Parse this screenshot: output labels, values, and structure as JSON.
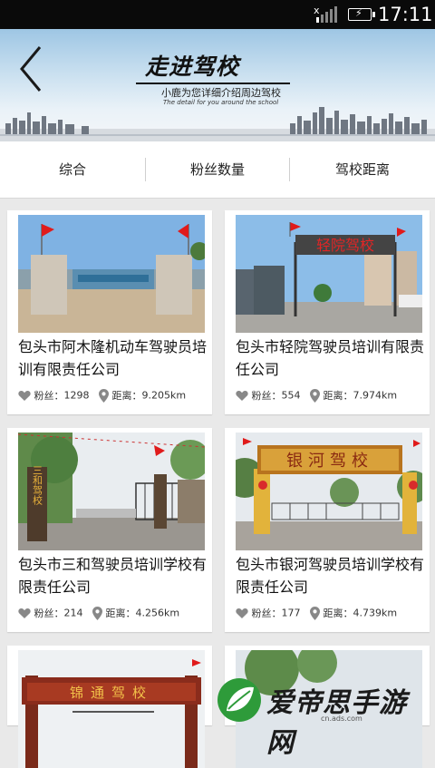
{
  "status_bar": {
    "time": "17:11"
  },
  "banner": {
    "title": "走进驾校",
    "subtitle": "小鹿为您详细介绍周边驾校",
    "subtitle_en": "The detail for you around the school"
  },
  "tabs": [
    {
      "label": "综合"
    },
    {
      "label": "粉丝数量"
    },
    {
      "label": "驾校距离"
    }
  ],
  "schools": [
    {
      "name": "包头市阿木隆机动车驾驶员培训有限责任公司",
      "fans_label": "粉丝：",
      "fans": "1298",
      "distance_label": "距离：",
      "distance": "9.205km"
    },
    {
      "name": "包头市轻院驾驶员培训有限责任公司",
      "fans_label": "粉丝：",
      "fans": "554",
      "distance_label": "距离：",
      "distance": "7.974km"
    },
    {
      "name": "包头市三和驾驶员培训学校有限责任公司",
      "fans_label": "粉丝：",
      "fans": "214",
      "distance_label": "距离：",
      "distance": "4.256km"
    },
    {
      "name": "包头市银河驾驶员培训学校有限责任公司",
      "fans_label": "粉丝：",
      "fans": "177",
      "distance_label": "距离：",
      "distance": "4.739km"
    }
  ],
  "photo_signs": {
    "card2": "轻院驾校",
    "card3": "三和驾校",
    "card4": "银河驾校",
    "card5": "锦通驾校"
  },
  "watermark": {
    "text": "爱帝思手游网",
    "url": "cn.ads.com"
  },
  "colors": {
    "accent_green": "#2e9b3a",
    "meta_grey": "#888888"
  }
}
